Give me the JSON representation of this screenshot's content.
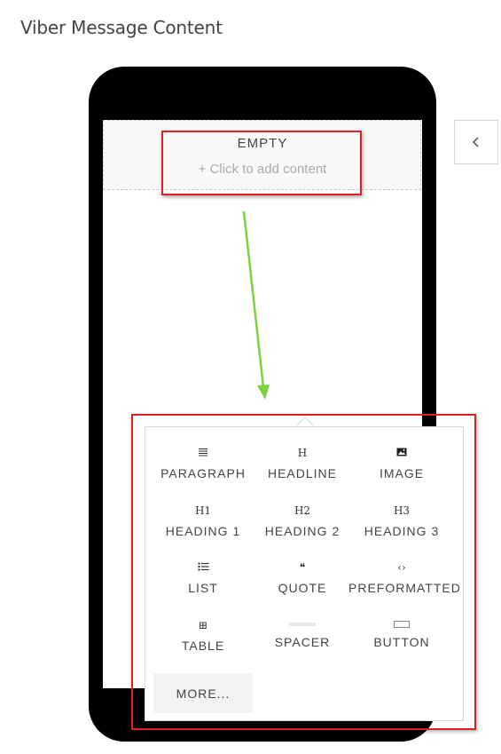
{
  "page": {
    "title": "Viber Message Content"
  },
  "empty_block": {
    "title": "EMPTY",
    "subtitle": "+ Click to add content"
  },
  "colors": {
    "highlight": "#e02020",
    "arrow": "#7cd23c",
    "phone": "#000000"
  },
  "collapse_button": {
    "icon": "chevron-left-icon"
  },
  "options": [
    {
      "label": "PARAGRAPH",
      "glyph": "≣",
      "icon": "paragraph-icon"
    },
    {
      "label": "HEADLINE",
      "glyph": "H",
      "icon": "headline-icon"
    },
    {
      "label": "IMAGE",
      "glyph": "",
      "icon": "image-icon"
    },
    {
      "label": "HEADING 1",
      "glyph": "H1",
      "icon": "heading-1-icon"
    },
    {
      "label": "HEADING 2",
      "glyph": "H2",
      "icon": "heading-2-icon"
    },
    {
      "label": "HEADING 3",
      "glyph": "H3",
      "icon": "heading-3-icon"
    },
    {
      "label": "LIST",
      "glyph": "",
      "icon": "list-icon"
    },
    {
      "label": "QUOTE",
      "glyph": "❝",
      "icon": "quote-icon"
    },
    {
      "label": "PREFORMATTED",
      "glyph": "‹›",
      "icon": "code-icon"
    },
    {
      "label": "TABLE",
      "glyph": "⊞",
      "icon": "table-icon"
    },
    {
      "label": "SPACER",
      "glyph": "",
      "icon": "spacer-icon"
    },
    {
      "label": "BUTTON",
      "glyph": "",
      "icon": "button-icon"
    }
  ],
  "more_button": {
    "label": "MORE..."
  }
}
